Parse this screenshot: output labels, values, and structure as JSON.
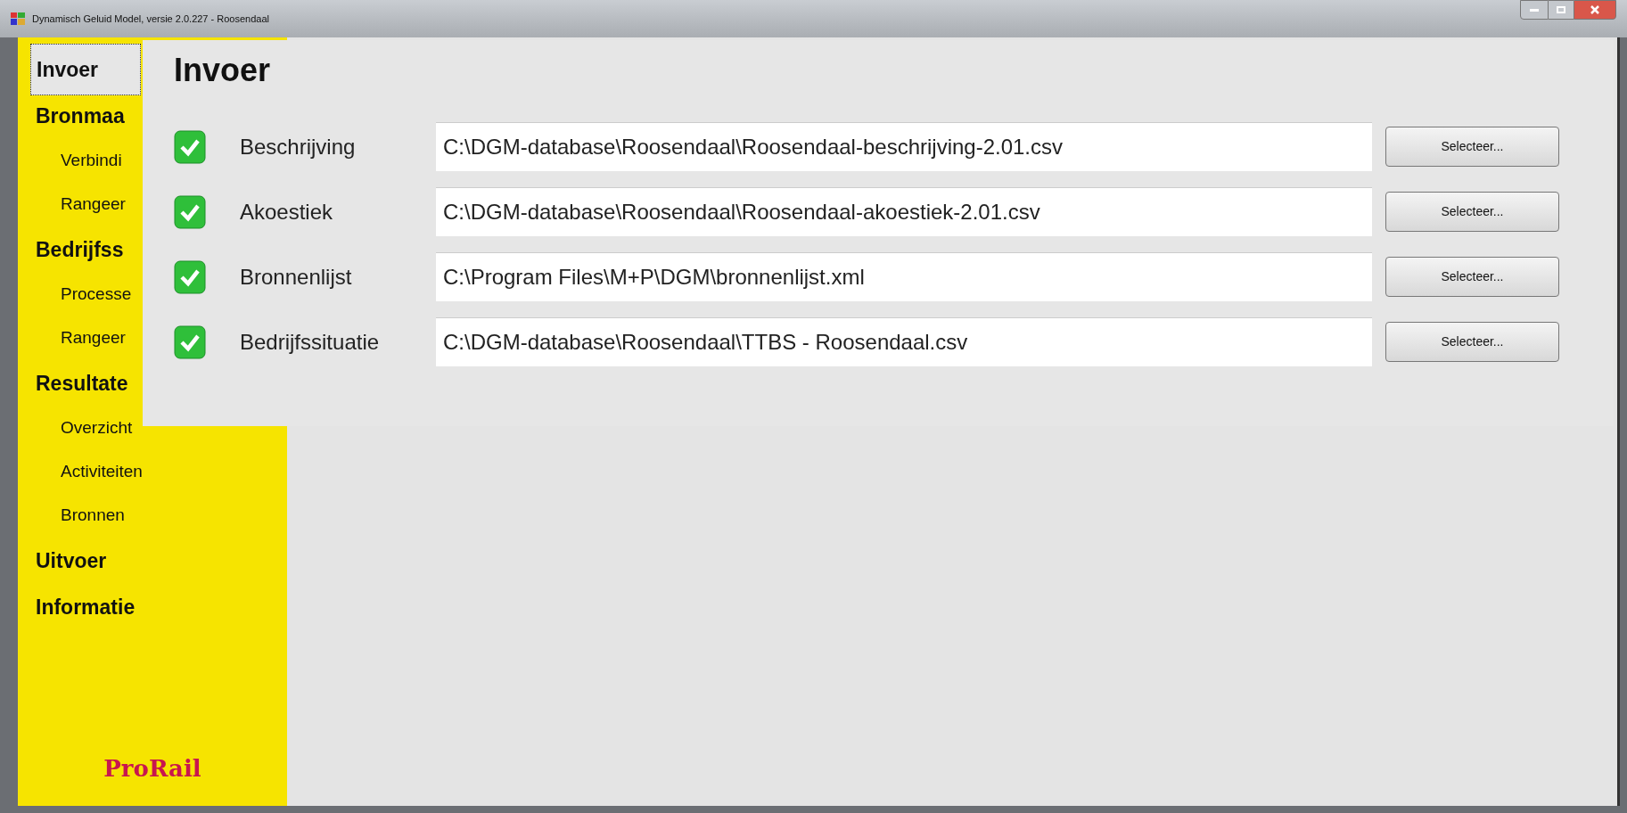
{
  "window": {
    "title": "Dynamisch Geluid Model, versie 2.0.227 - Roosendaal"
  },
  "sidebar": {
    "items": [
      {
        "label": "Invoer",
        "kind": "section",
        "selected": true
      },
      {
        "label": "Bronmaa",
        "kind": "section",
        "selected": false
      },
      {
        "label": "Verbindi",
        "kind": "sub",
        "selected": false
      },
      {
        "label": "Rangeer",
        "kind": "sub",
        "selected": false
      },
      {
        "label": "Bedrijfss",
        "kind": "section",
        "selected": false
      },
      {
        "label": "Processe",
        "kind": "sub",
        "selected": false
      },
      {
        "label": "Rangeer",
        "kind": "sub",
        "selected": false
      },
      {
        "label": "Resultate",
        "kind": "section",
        "selected": false
      },
      {
        "label": "Overzicht",
        "kind": "sub",
        "selected": false
      },
      {
        "label": "Activiteiten",
        "kind": "sub",
        "selected": false
      },
      {
        "label": "Bronnen",
        "kind": "sub",
        "selected": false
      },
      {
        "label": "Uitvoer",
        "kind": "section",
        "selected": false
      },
      {
        "label": "Informatie",
        "kind": "section",
        "selected": false
      }
    ],
    "logo": "ProRail"
  },
  "panel": {
    "title": "Invoer",
    "rows": [
      {
        "label": "Beschrijving",
        "checked": true,
        "value": "C:\\DGM-database\\Roosendaal\\Roosendaal-beschrijving-2.01.csv",
        "button": "Selecteer..."
      },
      {
        "label": "Akoestiek",
        "checked": true,
        "value": "C:\\DGM-database\\Roosendaal\\Roosendaal-akoestiek-2.01.csv",
        "button": "Selecteer..."
      },
      {
        "label": "Bronnenlijst",
        "checked": true,
        "value": "C:\\Program Files\\M+P\\DGM\\bronnenlijst.xml",
        "button": "Selecteer..."
      },
      {
        "label": "Bedrijfssituatie",
        "checked": true,
        "value": "C:\\DGM-database\\Roosendaal\\TTBS - Roosendaal.csv",
        "button": "Selecteer..."
      }
    ]
  }
}
